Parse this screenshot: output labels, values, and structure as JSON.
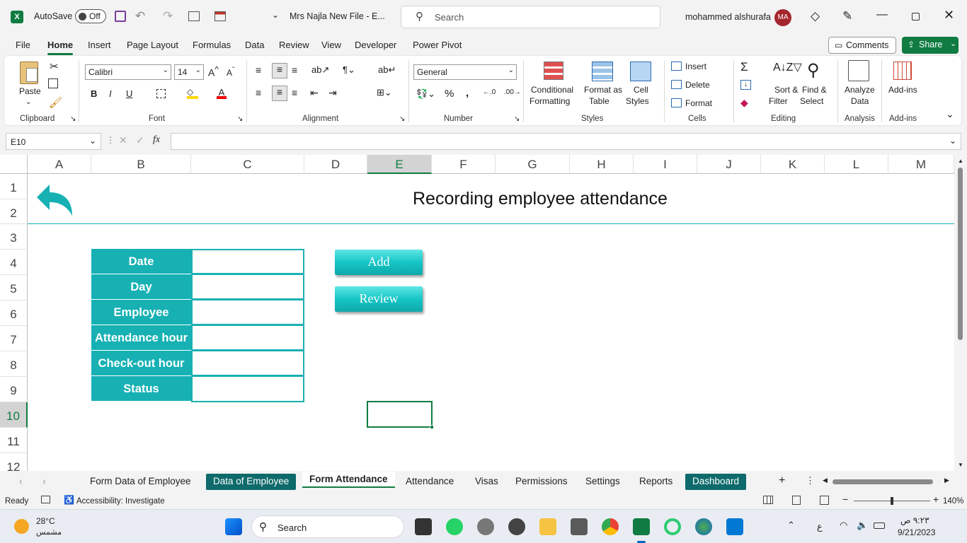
{
  "titlebar": {
    "autosave_label": "AutoSave",
    "autosave_state": "Off",
    "filename": "Mrs Najla New File  -  E...",
    "search_placeholder": "Search",
    "user_name": "mohammed alshurafa",
    "user_initials": "MA"
  },
  "menu": [
    "File",
    "Home",
    "Insert",
    "Page Layout",
    "Formulas",
    "Data",
    "Review",
    "View",
    "Developer",
    "Power Pivot"
  ],
  "comments_label": "Comments",
  "share_label": "Share",
  "ribbon": {
    "clipboard": {
      "paste": "Paste",
      "label": "Clipboard"
    },
    "font": {
      "name": "Calibri",
      "size": "14",
      "label": "Font"
    },
    "alignment": {
      "label": "Alignment"
    },
    "number": {
      "format": "General",
      "label": "Number"
    },
    "styles": {
      "conditional": "Conditional",
      "formatting": "Formatting",
      "format_as": "Format as",
      "table": "Table",
      "cell": "Cell",
      "styles": "Styles",
      "label": "Styles"
    },
    "cells": {
      "insert": "Insert",
      "delete": "Delete",
      "format": "Format",
      "label": "Cells"
    },
    "editing": {
      "sort": "Sort &",
      "filter": "Filter",
      "find": "Find &",
      "select": "Select",
      "label": "Editing"
    },
    "analysis": {
      "analyze": "Analyze",
      "data": "Data",
      "label": "Analysis"
    },
    "addins": {
      "addins": "Add-ins",
      "label": "Add-ins"
    }
  },
  "formula_bar": {
    "name_box": "E10",
    "fx": "fx",
    "value": ""
  },
  "columns": [
    "A",
    "B",
    "C",
    "D",
    "E",
    "F",
    "G",
    "H",
    "I",
    "J",
    "K",
    "L",
    "M"
  ],
  "rows": [
    "1",
    "2",
    "3",
    "4",
    "5",
    "6",
    "7",
    "8",
    "9",
    "10",
    "11",
    "12"
  ],
  "sheet": {
    "title": "Recording employee attendance",
    "form_labels": [
      "Date",
      "Day",
      "Employee",
      "Attendance hour",
      "Check-out hour",
      "Status"
    ],
    "add_button": "Add",
    "review_button": "Review",
    "selected_cell": "E10"
  },
  "tabs": [
    "Form Data of Employee",
    "Data of Employee",
    "Form Attendance",
    "Attendance",
    "Visas",
    "Permissions",
    "Settings",
    "Reports",
    "Dashboard"
  ],
  "active_tab": "Form Attendance",
  "status": {
    "ready": "Ready",
    "accessibility": "Accessibility: Investigate",
    "zoom": "140%"
  },
  "taskbar": {
    "temp": "28°C",
    "weather": "مشمس",
    "search": "Search",
    "lang": "ع",
    "time": "٩:٢٣ ص",
    "date": "9/21/2023"
  },
  "colors": {
    "teal": "#17b1b4",
    "excel_green": "#107c41",
    "dark_tab": "#0e6a6b"
  }
}
